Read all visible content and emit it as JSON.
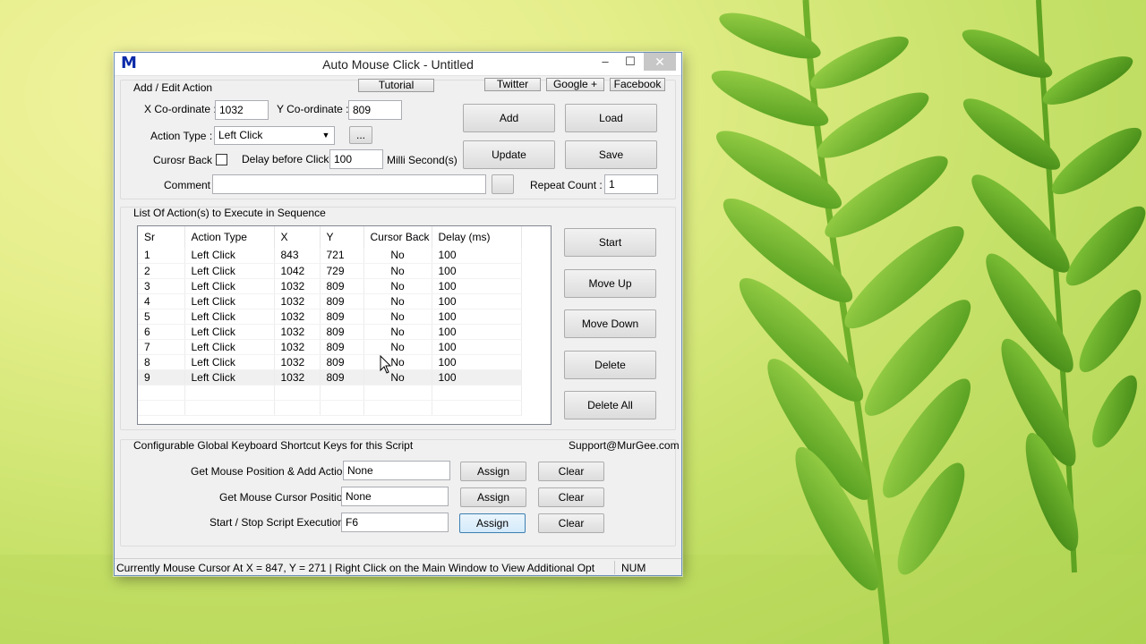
{
  "window": {
    "title": "Auto Mouse Click - Untitled",
    "icon_letter": "M",
    "minimize": "–",
    "maximize": "☐",
    "close": "✕"
  },
  "edit": {
    "group_title": "Add / Edit Action",
    "tutorial": "Tutorial",
    "twitter": "Twitter",
    "google": "Google +",
    "facebook": "Facebook",
    "x_label": "X Co-ordinate :",
    "x_value": "1032",
    "y_label": "Y Co-ordinate :",
    "y_value": "809",
    "action_type_label": "Action Type :",
    "action_type_value": "Left Click",
    "ellipsis": "...",
    "cursor_back_label": "Curosr Back :",
    "delay_label": "Delay before Click :",
    "delay_value": "100",
    "ms_label": "Milli Second(s)",
    "comment_label": "Comment :",
    "comment_value": "",
    "repeat_label": "Repeat Count :",
    "repeat_value": "1",
    "add": "Add",
    "load": "Load",
    "update": "Update",
    "save": "Save"
  },
  "list": {
    "group_title": "List Of Action(s) to Execute in Sequence",
    "columns": [
      "Sr",
      "Action Type",
      "X",
      "Y",
      "Cursor Back",
      "Delay (ms)"
    ],
    "rows": [
      [
        "1",
        "Left Click",
        "843",
        "721",
        "No",
        "100"
      ],
      [
        "2",
        "Left Click",
        "1042",
        "729",
        "No",
        "100"
      ],
      [
        "3",
        "Left Click",
        "1032",
        "809",
        "No",
        "100"
      ],
      [
        "4",
        "Left Click",
        "1032",
        "809",
        "No",
        "100"
      ],
      [
        "5",
        "Left Click",
        "1032",
        "809",
        "No",
        "100"
      ],
      [
        "6",
        "Left Click",
        "1032",
        "809",
        "No",
        "100"
      ],
      [
        "7",
        "Left Click",
        "1032",
        "809",
        "No",
        "100"
      ],
      [
        "8",
        "Left Click",
        "1032",
        "809",
        "No",
        "100"
      ],
      [
        "9",
        "Left Click",
        "1032",
        "809",
        "No",
        "100"
      ]
    ],
    "selected_row": 9,
    "start": "Start",
    "move_up": "Move Up",
    "move_down": "Move Down",
    "delete": "Delete",
    "delete_all": "Delete All"
  },
  "shortcuts": {
    "group_title": "Configurable Global Keyboard Shortcut Keys for this Script",
    "support": "Support@MurGee.com",
    "items": [
      {
        "label": "Get Mouse Position & Add Action :",
        "value": "None",
        "assign": "Assign",
        "clear": "Clear"
      },
      {
        "label": "Get Mouse Cursor Position :",
        "value": "None",
        "assign": "Assign",
        "clear": "Clear"
      },
      {
        "label": "Start / Stop Script Execution :",
        "value": "F6",
        "assign": "Assign",
        "clear": "Clear"
      }
    ]
  },
  "status": {
    "text": "Currently Mouse Cursor At X = 847, Y = 271 | Right Click on the Main Window to View Additional Opt",
    "num": "NUM"
  }
}
